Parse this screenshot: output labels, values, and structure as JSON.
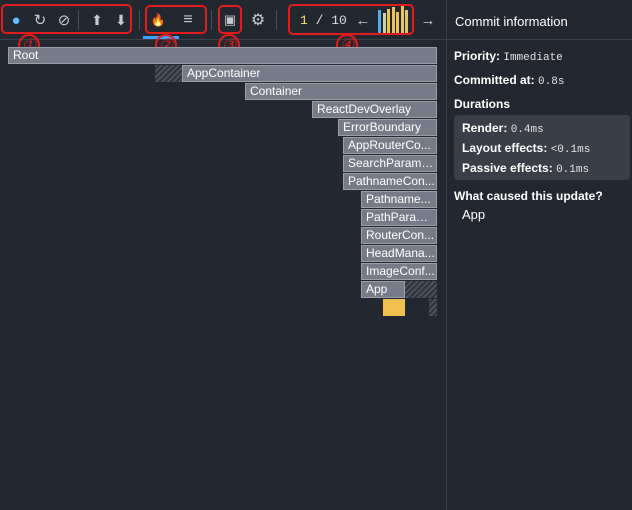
{
  "toolbar": {
    "buttons": [
      {
        "name": "record-icon",
        "glyph": "●",
        "color": "#61bfff"
      },
      {
        "name": "reload-icon",
        "glyph": "↻"
      },
      {
        "name": "clear-icon",
        "glyph": "⊘"
      },
      {
        "name": "upload-icon",
        "glyph": "⬆"
      },
      {
        "name": "download-icon",
        "glyph": "⬇"
      },
      {
        "name": "flamegraph-icon",
        "glyph": "🔥"
      },
      {
        "name": "ranked-icon",
        "glyph": "≡"
      },
      {
        "name": "timeline-icon",
        "glyph": "▣"
      },
      {
        "name": "settings-icon",
        "glyph": "⚙"
      }
    ],
    "commit_current": "1",
    "commit_total": "/ 10",
    "prev_glyph": "←",
    "next_glyph": "→",
    "commit_bars": [
      {
        "height": 0.85,
        "color": "#5aa9e6"
      },
      {
        "height": 0.75,
        "color": "#c9d6a0"
      },
      {
        "height": 0.9,
        "color": "#e8c45a"
      },
      {
        "height": 0.95,
        "color": "#e8c45a"
      },
      {
        "height": 0.8,
        "color": "#e8c45a"
      },
      {
        "height": 1.0,
        "color": "#e8c45a"
      },
      {
        "height": 0.85,
        "color": "#e8c45a"
      }
    ]
  },
  "annotations": [
    "①",
    "②",
    "③",
    "④"
  ],
  "flame": {
    "nodes": [
      "Root",
      "AppContainer",
      "Container",
      "ReactDevOverlay",
      "ErrorBoundary",
      "AppRouterCo...",
      "SearchParams...",
      "PathnameCon...",
      "Pathname...",
      "PathParam...",
      "RouterCon...",
      "HeadMana...",
      "ImageConf...",
      "App"
    ]
  },
  "panel": {
    "title": "Commit information",
    "priority_label": "Priority:",
    "priority_value": "Immediate",
    "committed_label": "Committed at:",
    "committed_value": "0.8s",
    "durations_label": "Durations",
    "render_label": "Render:",
    "render_value": "0.4ms",
    "layout_label": "Layout effects:",
    "layout_value": "<0.1ms",
    "passive_label": "Passive effects:",
    "passive_value": "0.1ms",
    "cause_label": "What caused this update?",
    "cause_value": "App"
  }
}
